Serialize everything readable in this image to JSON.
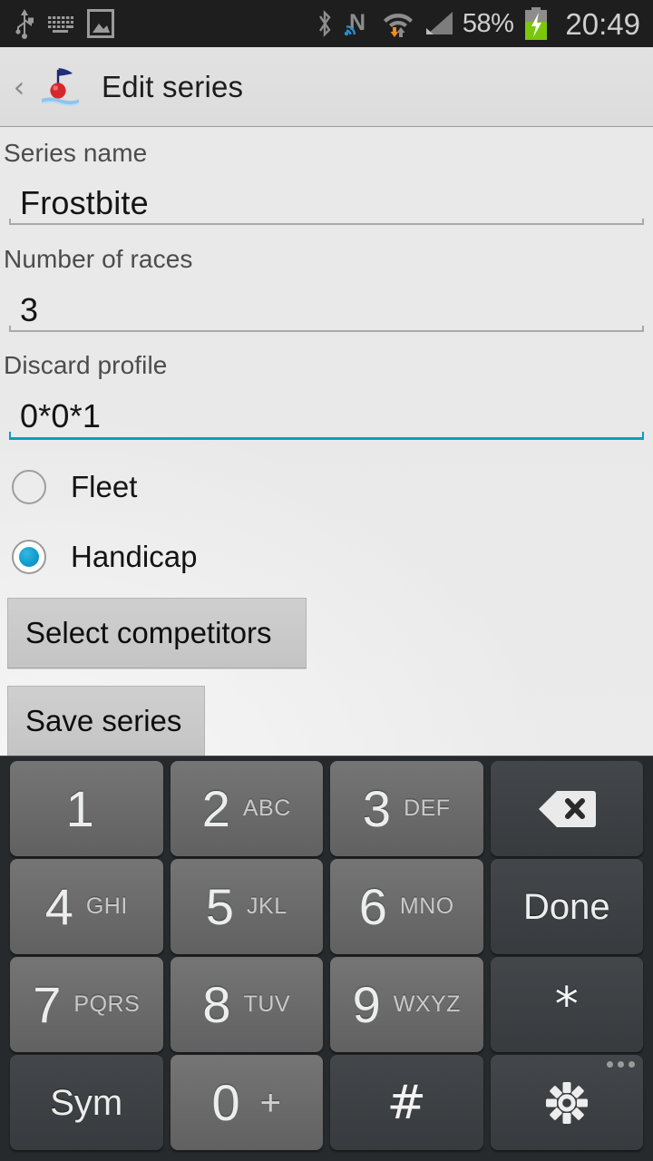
{
  "statusbar": {
    "left_icons": [
      "usb-icon",
      "keyboard-icon",
      "screenshot-image-icon"
    ],
    "right_icons": [
      "bluetooth-icon",
      "nfc-icon",
      "wifi-icon",
      "cellular-signal-icon"
    ],
    "battery_percent": "58%",
    "battery_state": "charging",
    "clock": "20:49",
    "background_color": "#1e1e1e",
    "text_color": "#cfcfcf"
  },
  "actionbar": {
    "up_caret": "‹",
    "app_icon": "racing-buoy-icon",
    "title": "Edit series"
  },
  "form": {
    "fields": [
      {
        "label": "Series name",
        "value": "Frostbite",
        "focused": false
      },
      {
        "label": "Number of races",
        "value": "3",
        "focused": false
      },
      {
        "label": "Discard profile",
        "value": "0*0*1",
        "focused": true
      }
    ],
    "scoring_options": [
      {
        "label": "Fleet",
        "selected": false
      },
      {
        "label": "Handicap",
        "selected": true
      }
    ],
    "buttons": [
      {
        "label": "Select competitors"
      },
      {
        "label": "Save series"
      }
    ],
    "accent_color": "#0c9dc4"
  },
  "keyboard": {
    "rows": [
      [
        {
          "kind": "num",
          "digit": "1",
          "letters": ""
        },
        {
          "kind": "num",
          "digit": "2",
          "letters": "ABC"
        },
        {
          "kind": "num",
          "digit": "3",
          "letters": "DEF"
        },
        {
          "kind": "fn",
          "icon": "backspace-icon",
          "label": ""
        }
      ],
      [
        {
          "kind": "num",
          "digit": "4",
          "letters": "GHI"
        },
        {
          "kind": "num",
          "digit": "5",
          "letters": "JKL"
        },
        {
          "kind": "num",
          "digit": "6",
          "letters": "MNO"
        },
        {
          "kind": "fn",
          "icon": "",
          "label": "Done"
        }
      ],
      [
        {
          "kind": "num",
          "digit": "7",
          "letters": "PQRS"
        },
        {
          "kind": "num",
          "digit": "8",
          "letters": "TUV"
        },
        {
          "kind": "num",
          "digit": "9",
          "letters": "WXYZ"
        },
        {
          "kind": "fn",
          "icon": "",
          "label": "*"
        }
      ],
      [
        {
          "kind": "fn",
          "icon": "",
          "label": "Sym"
        },
        {
          "kind": "num",
          "digit": "0",
          "letters": "",
          "plus": "+"
        },
        {
          "kind": "fn",
          "icon": "",
          "label": "#"
        },
        {
          "kind": "fn",
          "icon": "gear-icon",
          "label": "",
          "more_dots": true
        }
      ]
    ],
    "background_color": "#262a2c"
  }
}
